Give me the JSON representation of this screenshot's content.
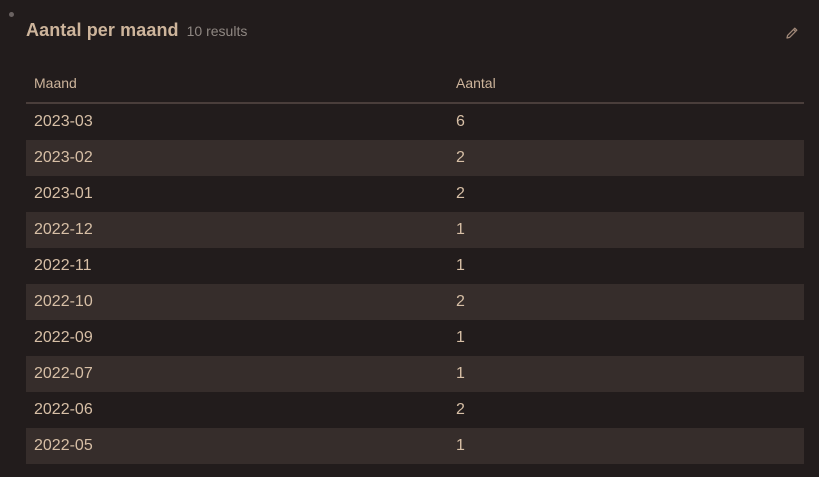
{
  "header": {
    "title": "Aantal per maand",
    "count": "10 results"
  },
  "table": {
    "columns": [
      "Maand",
      "Aantal"
    ],
    "rows": [
      [
        "2023-03",
        "6"
      ],
      [
        "2023-02",
        "2"
      ],
      [
        "2023-01",
        "2"
      ],
      [
        "2022-12",
        "1"
      ],
      [
        "2022-11",
        "1"
      ],
      [
        "2022-10",
        "2"
      ],
      [
        "2022-09",
        "1"
      ],
      [
        "2022-07",
        "1"
      ],
      [
        "2022-06",
        "2"
      ],
      [
        "2022-05",
        "1"
      ]
    ]
  },
  "colors": {
    "background": "#221c1c",
    "row_alt": "#362d2b",
    "accent_text": "#cdb49b",
    "muted_text": "#8f8782"
  },
  "icons": {
    "edit": "pencil-icon",
    "bullet": "dot-icon"
  }
}
